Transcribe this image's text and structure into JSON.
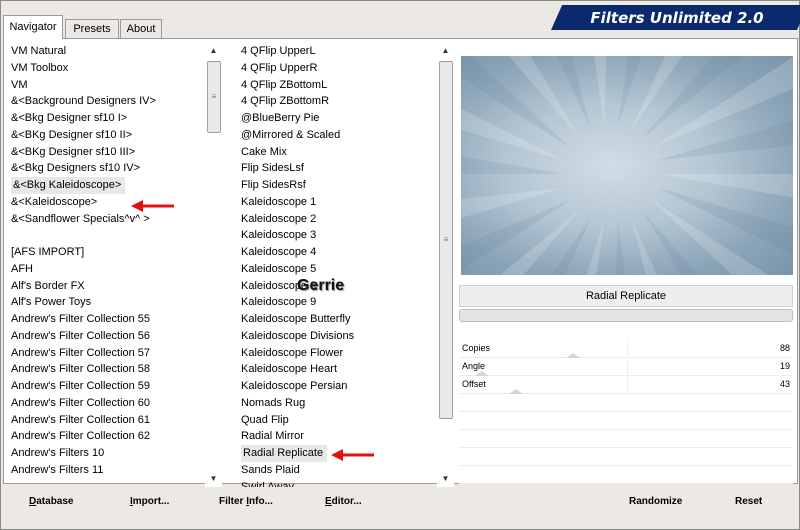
{
  "app": {
    "title": "Filters Unlimited 2.0"
  },
  "tabs": [
    {
      "label": "Navigator",
      "active": true
    },
    {
      "label": "Presets",
      "active": false
    },
    {
      "label": "About",
      "active": false
    }
  ],
  "categories": {
    "items": [
      "VM Natural",
      "VM Toolbox",
      "VM",
      "&<Background Designers IV>",
      "&<Bkg Designer sf10 I>",
      "&<BKg Designer sf10 II>",
      "&<BKg Designer sf10 III>",
      "&<Bkg Designers sf10 IV>",
      "&<Bkg Kaleidoscope>",
      "&<Kaleidoscope>",
      "&<Sandflower Specials^v^ >",
      "",
      "[AFS IMPORT]",
      "AFH",
      "Alf's Border FX",
      "Alf's Power Toys",
      "Andrew's Filter Collection 55",
      "Andrew's Filter Collection 56",
      "Andrew's Filter Collection 57",
      "Andrew's Filter Collection 58",
      "Andrew's Filter Collection 59",
      "Andrew's Filter Collection 60",
      "Andrew's Filter Collection 61",
      "Andrew's Filter Collection 62",
      "Andrew's Filters 10",
      "Andrew's Filters 11"
    ],
    "selected_index": 8
  },
  "filters": {
    "items": [
      "4 QFlip UpperL",
      "4 QFlip UpperR",
      "4 QFlip ZBottomL",
      "4 QFlip ZBottomR",
      "@BlueBerry Pie",
      "@Mirrored & Scaled",
      "Cake Mix",
      "Flip SidesLsf",
      "Flip SidesRsf",
      "Kaleidoscope 1",
      "Kaleidoscope 2",
      "Kaleidoscope 3",
      "Kaleidoscope 4",
      "Kaleidoscope 5",
      "Kaleidoscope 8",
      "Kaleidoscope 9",
      "Kaleidoscope Butterfly",
      "Kaleidoscope Divisions",
      "Kaleidoscope Flower",
      "Kaleidoscope Heart",
      "Kaleidoscope Persian",
      "Nomads Rug",
      "Quad Flip",
      "Radial Mirror",
      "Radial Replicate",
      "Sands Plaid",
      "Swirl Away"
    ],
    "selected_index": 24
  },
  "preview": {
    "filter_name": "Radial Replicate",
    "colors": {
      "light": "#d2dde6",
      "dark": "#7a94a9"
    }
  },
  "params": [
    {
      "label": "Copies",
      "value": "88",
      "level": 0.34
    },
    {
      "label": "Angle",
      "value": "19",
      "level": 0.07
    },
    {
      "label": "Offset",
      "value": "43",
      "level": 0.17
    }
  ],
  "buttons": {
    "database": {
      "first": "D",
      "rest": "atabase"
    },
    "import": {
      "first": "I",
      "rest": "mport..."
    },
    "filter_info": {
      "pre": "Filter ",
      "first": "I",
      "rest": "nfo..."
    },
    "editor": {
      "first": "E",
      "rest": "ditor..."
    },
    "randomize": "Randomize",
    "reset": "Reset"
  },
  "annotation": {
    "watermark": "Gerrie"
  }
}
